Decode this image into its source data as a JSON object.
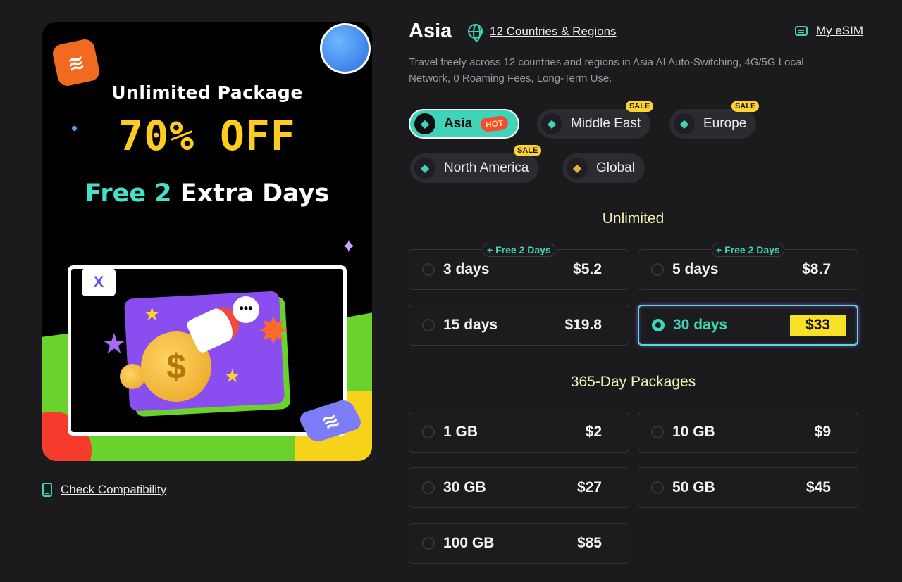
{
  "banner": {
    "line1": "Unlimited Package",
    "line2": "70% OFF",
    "line3_highlight": "Free 2",
    "line3_rest": " Extra Days",
    "logo_letter": "X"
  },
  "check_compatibility": "Check Compatibility",
  "header": {
    "title": "Asia",
    "regions_link": "12 Countries & Regions",
    "my_esim": "My eSIM",
    "description": "Travel freely across 12 countries and regions in Asia AI Auto-Switching, 4G/5G Local Network, 0 Roaming Fees, Long-Term Use."
  },
  "regions": [
    {
      "label": "Asia",
      "badge": "HOT",
      "active": true
    },
    {
      "label": "Middle East",
      "badge": "SALE",
      "active": false
    },
    {
      "label": "Europe",
      "badge": "SALE",
      "active": false
    },
    {
      "label": "North America",
      "badge": "SALE",
      "active": false
    },
    {
      "label": "Global",
      "badge": "",
      "active": false
    }
  ],
  "unlimited": {
    "heading": "Unlimited",
    "options": [
      {
        "label": "3 days",
        "price": "$5.2",
        "badge": "+ Free 2 Days",
        "selected": false
      },
      {
        "label": "5 days",
        "price": "$8.7",
        "badge": "+ Free 2 Days",
        "selected": false
      },
      {
        "label": "15 days",
        "price": "$19.8",
        "badge": "",
        "selected": false
      },
      {
        "label": "30 days",
        "price": "$33",
        "badge": "",
        "selected": true
      }
    ]
  },
  "yearly": {
    "heading": "365-Day Packages",
    "options": [
      {
        "label": "1 GB",
        "price": "$2"
      },
      {
        "label": "10 GB",
        "price": "$9"
      },
      {
        "label": "30 GB",
        "price": "$27"
      },
      {
        "label": "50 GB",
        "price": "$45"
      },
      {
        "label": "100 GB",
        "price": "$85"
      }
    ]
  },
  "colors": {
    "background": "#1b1b1e",
    "accent_teal": "#3fd4b8",
    "price_highlight": "#f7e026",
    "section_heading": "#f4f0b6",
    "hot_badge": "#f5493a",
    "sale_badge": "#ffd234"
  }
}
